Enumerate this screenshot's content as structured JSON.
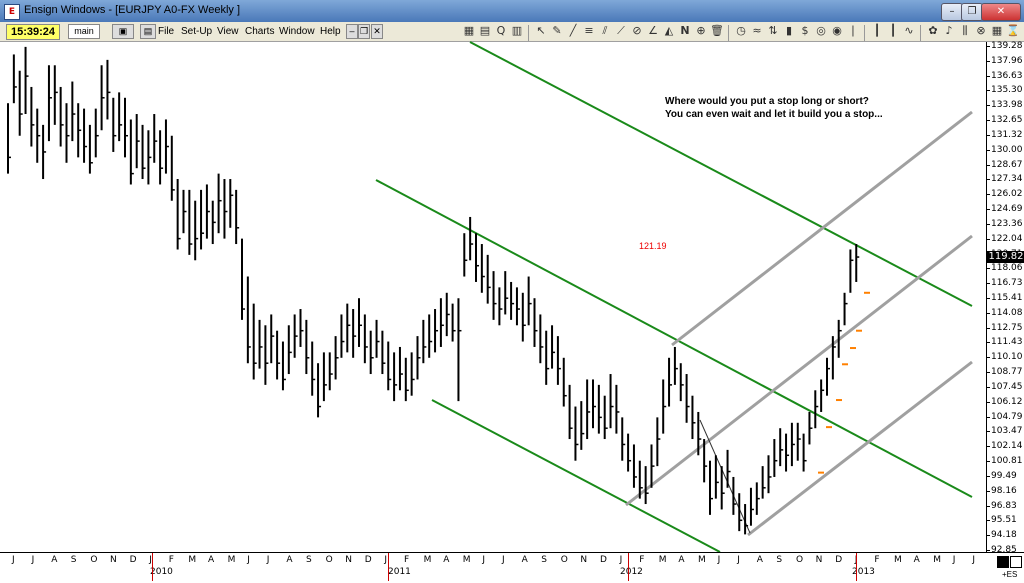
{
  "window": {
    "title": "Ensign Windows - [EURJPY A0-FX Weekly ]",
    "app_icon": "E"
  },
  "toolbar": {
    "clock": "15:39:24",
    "layout_name": "main",
    "menus": [
      "File",
      "Set-Up",
      "View",
      "Charts",
      "Window",
      "Help"
    ]
  },
  "annotation": {
    "line1": "Where would you put a stop long or short?",
    "line2": "You can even wait and let it build you a stop..."
  },
  "price_marker": "121.19",
  "current_price": "119.82",
  "corner_label": "+ES",
  "chart_data": {
    "type": "ohlc",
    "symbol": "EURJPY",
    "timeframe": "Weekly",
    "price_labels": [
      "139.28",
      "137.96",
      "136.63",
      "135.30",
      "133.98",
      "132.65",
      "131.32",
      "130.00",
      "128.67",
      "127.34",
      "126.02",
      "124.69",
      "123.36",
      "122.04",
      "120.71",
      "118.06",
      "116.73",
      "115.41",
      "114.08",
      "112.75",
      "111.43",
      "110.10",
      "108.77",
      "107.45",
      "106.12",
      "104.79",
      "103.47",
      "102.14",
      "100.81",
      "99.49",
      "98.16",
      "96.83",
      "95.51",
      "94.18",
      "92.85"
    ],
    "ylim": [
      92.85,
      139.28
    ],
    "months": [
      "J",
      "J",
      "A",
      "S",
      "O",
      "N",
      "D",
      "J",
      "F",
      "M",
      "A",
      "M",
      "J",
      "J",
      "A",
      "S",
      "O",
      "N",
      "D",
      "J",
      "F",
      "M",
      "A",
      "M",
      "J",
      "J",
      "A",
      "S",
      "O",
      "N",
      "D",
      "J",
      "F",
      "M",
      "A",
      "M",
      "J",
      "J",
      "A",
      "S",
      "O",
      "N",
      "D",
      "J",
      "F",
      "M",
      "A",
      "M",
      "J",
      "J"
    ],
    "years": [
      "2010",
      "2011",
      "2012",
      "2013"
    ],
    "bars": [
      [
        127.5,
        134.0,
        129.0
      ],
      [
        134.0,
        138.5,
        135.5
      ],
      [
        131.0,
        137.0,
        133.0
      ],
      [
        133.0,
        139.2,
        136.5
      ],
      [
        130.0,
        135.5,
        132.0
      ],
      [
        128.5,
        133.5,
        131.0
      ],
      [
        127.0,
        132.0,
        129.5
      ],
      [
        130.5,
        137.5,
        134.5
      ],
      [
        132.0,
        137.5,
        135.0
      ],
      [
        130.0,
        135.5,
        132.0
      ],
      [
        128.5,
        134.0,
        131.0
      ],
      [
        130.5,
        136.0,
        133.0
      ],
      [
        129.0,
        134.0,
        131.5
      ],
      [
        128.5,
        133.5,
        130.0
      ],
      [
        127.5,
        132.0,
        128.5
      ],
      [
        129.0,
        133.5,
        131.0
      ],
      [
        131.5,
        137.5,
        134.5
      ],
      [
        132.5,
        138.0,
        135.0
      ],
      [
        129.5,
        134.5,
        131.0
      ],
      [
        130.5,
        135.0,
        132.0
      ],
      [
        129.0,
        134.5,
        131.0
      ],
      [
        126.5,
        132.5,
        127.5
      ],
      [
        128.0,
        133.0,
        130.5
      ],
      [
        127.0,
        132.0,
        128.0
      ],
      [
        126.5,
        131.5,
        129.0
      ],
      [
        128.5,
        133.0,
        130.5
      ],
      [
        126.5,
        131.5,
        128.0
      ],
      [
        127.5,
        132.5,
        130.0
      ],
      [
        125.0,
        131.0,
        126.0
      ],
      [
        120.5,
        127.0,
        121.5
      ],
      [
        122.0,
        126.0,
        124.0
      ],
      [
        120.0,
        126.0,
        121.0
      ],
      [
        119.5,
        125.0,
        121.5
      ],
      [
        120.5,
        126.0,
        122.0
      ],
      [
        121.5,
        126.5,
        124.0
      ],
      [
        121.0,
        125.0,
        123.0
      ],
      [
        122.0,
        127.5,
        125.0
      ],
      [
        121.5,
        127.0,
        124.0
      ],
      [
        122.5,
        127.0,
        125.5
      ],
      [
        121.0,
        126.0,
        122.5
      ],
      [
        114.0,
        121.5,
        115.0
      ],
      [
        110.0,
        118.0,
        111.5
      ],
      [
        108.5,
        115.5,
        110.0
      ],
      [
        109.5,
        114.0,
        111.5
      ],
      [
        108.0,
        113.5,
        110.0
      ],
      [
        110.0,
        114.5,
        112.5
      ],
      [
        108.5,
        113.0,
        110.0
      ],
      [
        107.5,
        112.0,
        108.5
      ],
      [
        109.0,
        113.5,
        111.0
      ],
      [
        110.5,
        114.5,
        112.5
      ],
      [
        111.5,
        115.0,
        113.0
      ],
      [
        109.0,
        114.0,
        110.5
      ],
      [
        107.0,
        112.0,
        108.5
      ],
      [
        105.0,
        110.0,
        106.0
      ],
      [
        106.5,
        111.0,
        108.0
      ],
      [
        107.5,
        111.0,
        109.0
      ],
      [
        108.5,
        112.5,
        110.5
      ],
      [
        110.5,
        114.5,
        112.0
      ],
      [
        111.0,
        115.5,
        113.5
      ],
      [
        110.5,
        115.0,
        112.5
      ],
      [
        111.5,
        116.0,
        113.5
      ],
      [
        110.0,
        114.5,
        111.5
      ],
      [
        109.0,
        113.0,
        110.5
      ],
      [
        110.5,
        114.0,
        112.0
      ],
      [
        109.0,
        113.0,
        110.0
      ],
      [
        107.5,
        112.0,
        108.5
      ],
      [
        106.5,
        111.0,
        108.0
      ],
      [
        107.5,
        111.5,
        109.0
      ],
      [
        106.5,
        110.5,
        107.5
      ],
      [
        107.0,
        111.0,
        108.5
      ],
      [
        108.5,
        112.5,
        110.5
      ],
      [
        110.0,
        114.0,
        111.5
      ],
      [
        110.5,
        114.5,
        112.0
      ],
      [
        111.0,
        115.0,
        113.0
      ],
      [
        111.5,
        116.0,
        113.5
      ],
      [
        112.5,
        116.5,
        114.5
      ],
      [
        112.0,
        115.5,
        113.0
      ],
      [
        106.5,
        116.0,
        113.0
      ],
      [
        118.0,
        122.0,
        119.5
      ],
      [
        119.5,
        123.5,
        121.0
      ],
      [
        117.5,
        122.0,
        119.0
      ],
      [
        116.5,
        121.0,
        118.0
      ],
      [
        115.5,
        120.0,
        117.0
      ],
      [
        114.0,
        118.5,
        115.5
      ],
      [
        113.5,
        117.0,
        115.0
      ],
      [
        114.5,
        118.5,
        116.0
      ],
      [
        114.0,
        117.5,
        115.5
      ],
      [
        113.5,
        117.0,
        115.0
      ],
      [
        112.0,
        116.5,
        113.5
      ],
      [
        113.5,
        118.0,
        115.5
      ],
      [
        111.5,
        116.0,
        113.0
      ],
      [
        110.0,
        114.5,
        111.5
      ],
      [
        108.0,
        113.0,
        109.5
      ],
      [
        109.5,
        113.5,
        111.0
      ],
      [
        108.0,
        112.5,
        109.5
      ],
      [
        106.0,
        110.5,
        107.0
      ],
      [
        103.0,
        108.0,
        104.0
      ],
      [
        101.0,
        106.0,
        102.5
      ],
      [
        102.0,
        106.5,
        103.5
      ],
      [
        103.0,
        108.5,
        105.5
      ],
      [
        104.0,
        108.5,
        106.0
      ],
      [
        103.5,
        108.0,
        105.0
      ],
      [
        103.0,
        107.0,
        104.0
      ],
      [
        104.0,
        109.0,
        106.0
      ],
      [
        103.5,
        108.0,
        105.5
      ],
      [
        101.0,
        105.0,
        102.5
      ],
      [
        100.0,
        103.5,
        101.0
      ],
      [
        98.5,
        102.5,
        99.5
      ],
      [
        97.5,
        101.0,
        98.5
      ],
      [
        97.0,
        100.5,
        98.0
      ],
      [
        98.5,
        102.5,
        100.5
      ],
      [
        100.5,
        105.0,
        103.0
      ],
      [
        103.5,
        108.5,
        106.0
      ],
      [
        106.0,
        110.5,
        108.0
      ],
      [
        108.0,
        111.5,
        109.5
      ],
      [
        106.5,
        110.0,
        108.0
      ],
      [
        104.5,
        109.0,
        106.0
      ],
      [
        103.0,
        107.0,
        104.5
      ],
      [
        101.5,
        105.5,
        103.0
      ],
      [
        99.0,
        103.0,
        100.5
      ],
      [
        96.0,
        101.0,
        97.5
      ],
      [
        97.5,
        101.5,
        99.0
      ],
      [
        96.5,
        100.5,
        98.0
      ],
      [
        98.5,
        102.0,
        100.0
      ],
      [
        96.0,
        99.5,
        97.0
      ],
      [
        94.5,
        98.0,
        95.5
      ],
      [
        94.2,
        97.0,
        95.0
      ],
      [
        95.0,
        98.5,
        96.5
      ],
      [
        96.0,
        99.0,
        97.5
      ],
      [
        97.5,
        100.5,
        98.5
      ],
      [
        98.0,
        101.5,
        99.5
      ],
      [
        99.5,
        103.0,
        101.0
      ],
      [
        100.5,
        104.0,
        102.0
      ],
      [
        100.0,
        103.5,
        101.5
      ],
      [
        100.5,
        104.5,
        102.5
      ],
      [
        101.0,
        104.5,
        103.0
      ],
      [
        100.0,
        103.5,
        101.0
      ],
      [
        102.5,
        105.5,
        104.0
      ],
      [
        104.0,
        107.5,
        106.0
      ],
      [
        105.5,
        108.5,
        107.5
      ],
      [
        107.0,
        110.5,
        109.5
      ],
      [
        108.5,
        112.5,
        111.5
      ],
      [
        110.5,
        114.0,
        113.0
      ],
      [
        113.5,
        116.5,
        115.5
      ],
      [
        116.5,
        120.5,
        119.5
      ],
      [
        117.5,
        121.0,
        119.8
      ]
    ],
    "stop_markers": [
      [
        100.8,
        99.9
      ],
      [
        103.5,
        104.1
      ],
      [
        106.0,
        106.6
      ],
      [
        110.0,
        109.9
      ],
      [
        112.0,
        111.4
      ],
      [
        113.5,
        113.0
      ],
      [
        116.0,
        116.5
      ]
    ],
    "trend_lines": {
      "green": "downtrend channel lines",
      "gray": "uptrend channel lines"
    },
    "colors": {
      "green_line": "#1a8a1a",
      "gray_line": "#a0a0a0",
      "bar_color": "#000000",
      "stop_color": "#ff8000"
    }
  }
}
